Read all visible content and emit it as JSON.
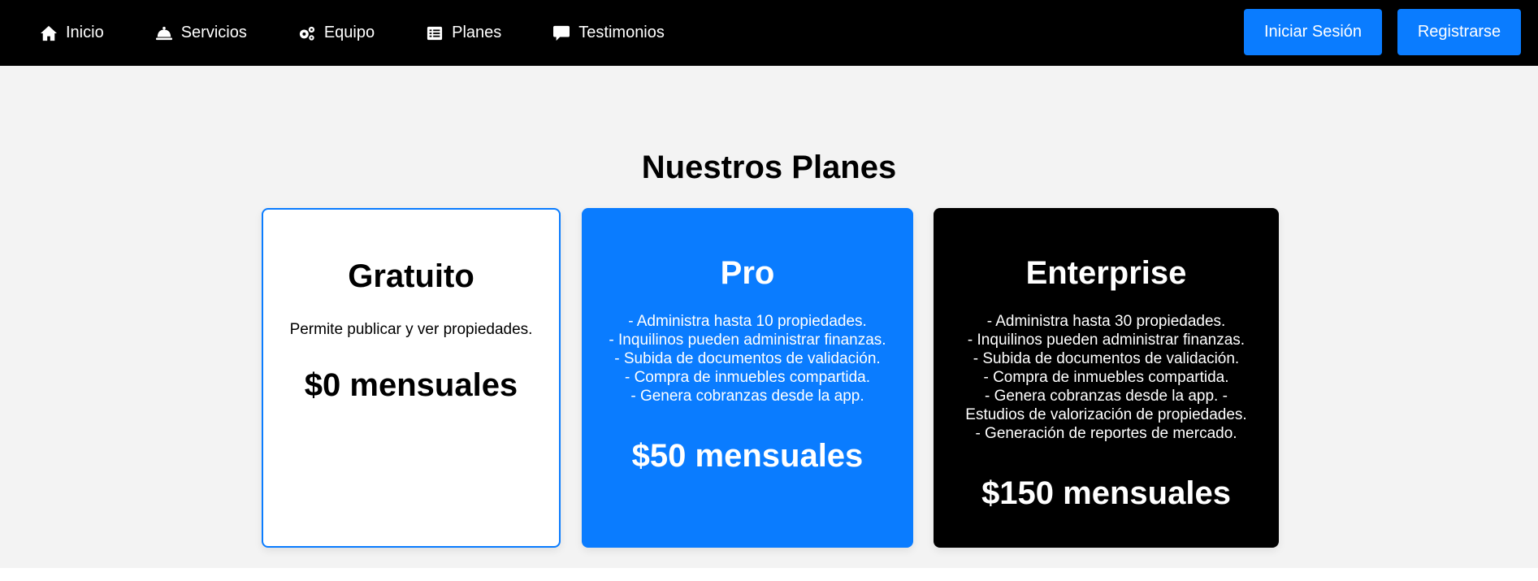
{
  "nav": {
    "items": [
      {
        "label": "Inicio",
        "icon": "home-icon"
      },
      {
        "label": "Servicios",
        "icon": "bell-icon"
      },
      {
        "label": "Equipo",
        "icon": "gears-icon"
      },
      {
        "label": "Planes",
        "icon": "list-icon"
      },
      {
        "label": "Testimonios",
        "icon": "comment-icon"
      }
    ],
    "login_label": "Iniciar Sesión",
    "register_label": "Registrarse"
  },
  "plans": {
    "title": "Nuestros Planes",
    "cards": [
      {
        "name": "Gratuito",
        "features": "Permite publicar y ver propiedades.",
        "price": "$0 mensuales"
      },
      {
        "name": "Pro",
        "features": "- Administra hasta 10 propiedades.\n- Inquilinos pueden administrar finanzas.\n- Subida de documentos de validación.\n- Compra de inmuebles compartida.\n- Genera cobranzas desde la app.",
        "price": "$50 mensuales"
      },
      {
        "name": "Enterprise",
        "features": "- Administra hasta 30 propiedades.\n- Inquilinos pueden administrar finanzas.\n- Subida de documentos de validación.\n- Compra de inmuebles compartida.\n- Genera cobranzas desde la app. -\nEstudios de valorización de propiedades.\n- Generación de reportes de mercado.",
        "price": "$150 mensuales"
      }
    ]
  },
  "colors": {
    "nav_bg": "#000000",
    "accent": "#0a7cff",
    "section_bg": "#f3f3f3"
  }
}
